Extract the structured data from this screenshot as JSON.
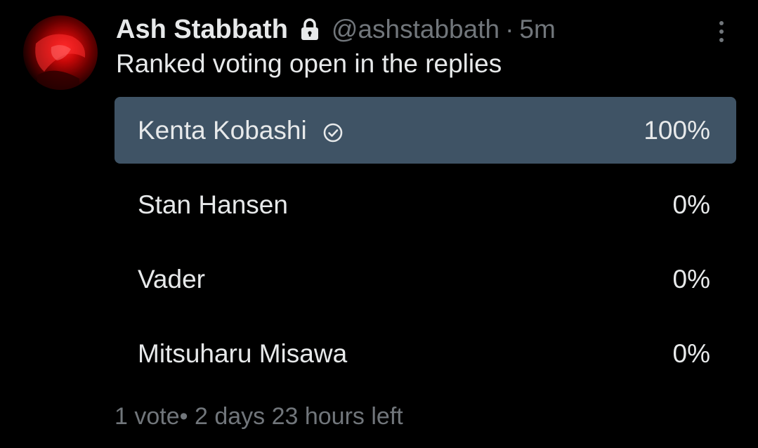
{
  "author": {
    "display_name": "Ash Stabbath",
    "handle": "@ashstabbath",
    "separator": "·",
    "timestamp": "5m",
    "locked_icon": "lock-icon",
    "avatar_icon": "avatar-image"
  },
  "tweet": {
    "text": "Ranked voting open in the replies",
    "more_icon": "more-vertical-icon"
  },
  "poll": {
    "options": [
      {
        "label": "Kenta Kobashi",
        "percent_text": "100%",
        "fraction": 1.0,
        "selected": true
      },
      {
        "label": "Stan Hansen",
        "percent_text": "0%",
        "fraction": 0.0,
        "selected": false
      },
      {
        "label": "Vader",
        "percent_text": "0%",
        "fraction": 0.0,
        "selected": false
      },
      {
        "label": "Mitsuharu Misawa",
        "percent_text": "0%",
        "fraction": 0.0,
        "selected": false
      }
    ],
    "footer": "1 vote• 2 days 23 hours left",
    "selected_icon": "check-circle-icon"
  },
  "colors": {
    "background": "#000000",
    "primary_text": "#e7e9ea",
    "secondary_text": "#71767b",
    "bar_fill": "#3f5365"
  }
}
